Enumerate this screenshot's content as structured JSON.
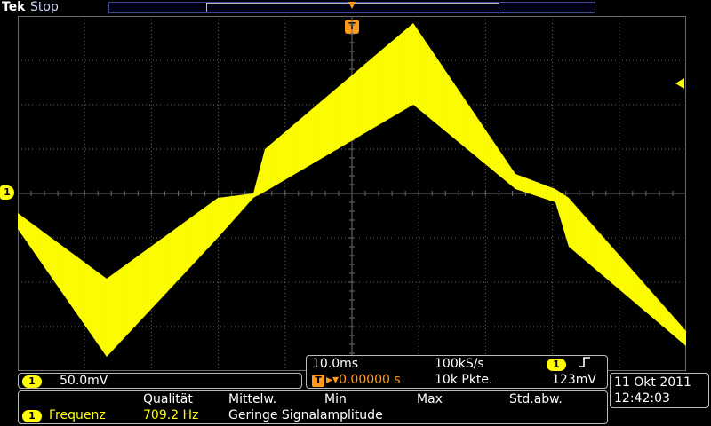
{
  "header": {
    "brand": "Tek",
    "status": "Stop"
  },
  "markers": {
    "channel_label": "1",
    "trigger_label": "T"
  },
  "channel_panel": {
    "channel": "1",
    "scale": "50.0mV"
  },
  "timebase_panel": {
    "time_per_div": "10.0ms",
    "sample_rate": "100kS/s",
    "trigger_delay": "0.00000 s",
    "record_length": "10k Pkte.",
    "trigger_source": "1",
    "trigger_slope_icon": "rising-edge-icon",
    "trigger_level": "123mV"
  },
  "datetime": {
    "date": "11 Okt  2011",
    "time": "12:42:03"
  },
  "measurements": {
    "headers": [
      "Qualität",
      "Mittelw.",
      "Min",
      "Max",
      "Std.abw."
    ],
    "row": {
      "channel": "1",
      "name": "Frequenz",
      "value": "709.2 Hz",
      "note": "Geringe Signalamplitude"
    }
  },
  "colors": {
    "trace": "#ffff00",
    "trigger": "#ff9a1a",
    "grid": "#6a6a6a",
    "background": "#000000"
  }
}
